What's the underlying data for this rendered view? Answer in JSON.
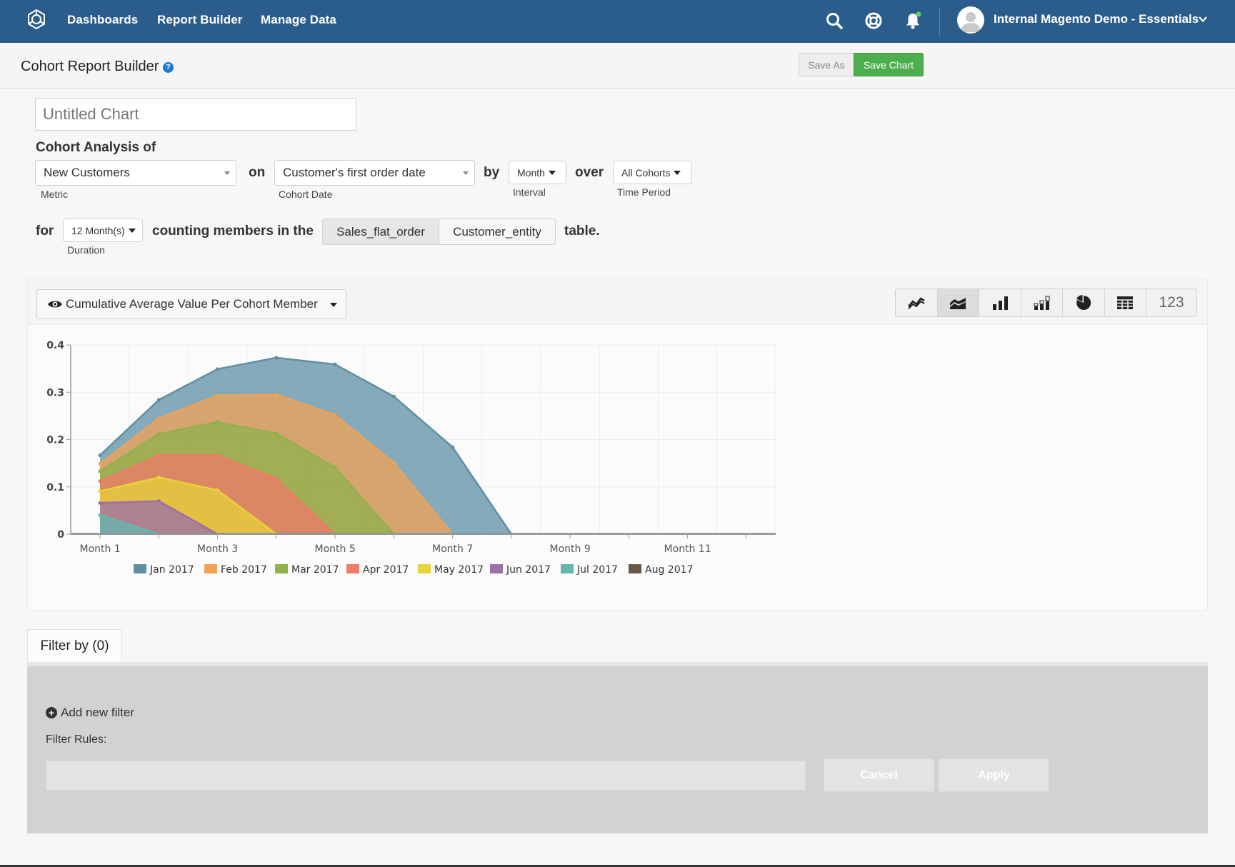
{
  "nav": {
    "links": [
      "Dashboards",
      "Report Builder",
      "Manage Data"
    ],
    "account": "Internal Magento Demo - Essentials"
  },
  "header": {
    "title": "Cohort Report Builder",
    "help": "?",
    "save_as": "Save As",
    "save_chart": "Save Chart"
  },
  "builder": {
    "chart_name_placeholder": "Untitled Chart",
    "cohort_analysis_of": "Cohort Analysis of",
    "metric_value": "New Customers",
    "metric_label": "Metric",
    "on": "on",
    "cohort_date_value": "Customer's first order date",
    "cohort_date_label": "Cohort Date",
    "by": "by",
    "interval_value": "Month",
    "interval_label": "Interval",
    "over": "over",
    "time_period_value": "All Cohorts",
    "time_period_label": "Time Period",
    "for": "for",
    "duration_value": "12 Month(s)",
    "duration_label": "Duration",
    "counting": "counting members in the",
    "tables": [
      "Sales_flat_order",
      "Customer_entity"
    ],
    "table_suffix": "table."
  },
  "chart_toolbar": {
    "metric_view": "Cumulative Average Value Per Cohort Member",
    "number_view": "123",
    "active_view": "area"
  },
  "chart_data": {
    "type": "area",
    "stacked": false,
    "x": [
      "Month 1",
      "Month 2",
      "Month 3",
      "Month 4",
      "Month 5",
      "Month 6",
      "Month 7",
      "Month 8",
      "Month 9",
      "Month 10",
      "Month 11",
      "Month 12"
    ],
    "xticks_shown": [
      "Month 1",
      "Month 3",
      "Month 5",
      "Month 7",
      "Month 9",
      "Month 11"
    ],
    "ylim": [
      0,
      0.4
    ],
    "yticks": [
      "0",
      "0.1",
      "0.2",
      "0.3",
      "0.4"
    ],
    "grid": true,
    "legend_position": "bottom",
    "series": [
      {
        "name": "Jan 2017",
        "color": "#5e8fa5",
        "values": [
          0.167,
          0.284,
          0.349,
          0.373,
          0.359,
          0.291,
          0.184,
          0,
          0,
          0,
          0,
          0
        ]
      },
      {
        "name": "Feb 2017",
        "color": "#f0a155",
        "values": [
          0.149,
          0.245,
          0.293,
          0.295,
          0.252,
          0.151,
          0,
          0,
          0,
          0,
          0,
          0
        ]
      },
      {
        "name": "Mar 2017",
        "color": "#8fb24a",
        "values": [
          0.133,
          0.212,
          0.237,
          0.213,
          0.141,
          0,
          0,
          0,
          0,
          0,
          0,
          0
        ]
      },
      {
        "name": "Apr 2017",
        "color": "#ef7a68",
        "values": [
          0.112,
          0.167,
          0.167,
          0.117,
          0,
          0,
          0,
          0,
          0,
          0,
          0,
          0
        ]
      },
      {
        "name": "May 2017",
        "color": "#e6d23a",
        "values": [
          0.091,
          0.12,
          0.093,
          0,
          0,
          0,
          0,
          0,
          0,
          0,
          0,
          0
        ]
      },
      {
        "name": "Jun 2017",
        "color": "#9b6fa8",
        "values": [
          0.066,
          0.07,
          0,
          0,
          0,
          0,
          0,
          0,
          0,
          0,
          0,
          0
        ]
      },
      {
        "name": "Jul 2017",
        "color": "#64b7b0",
        "values": [
          0.04,
          0,
          0,
          0,
          0,
          0,
          0,
          0,
          0,
          0,
          0,
          0
        ]
      },
      {
        "name": "Aug 2017",
        "color": "#6b5844",
        "values": [
          0,
          0,
          0,
          0,
          0,
          0,
          0,
          0,
          0,
          0,
          0,
          0
        ]
      }
    ]
  },
  "filter": {
    "tab_label": "Filter by (0)",
    "add_new": "Add new filter",
    "rules_label": "Filter Rules:",
    "cancel": "Cancel",
    "apply": "Apply"
  }
}
